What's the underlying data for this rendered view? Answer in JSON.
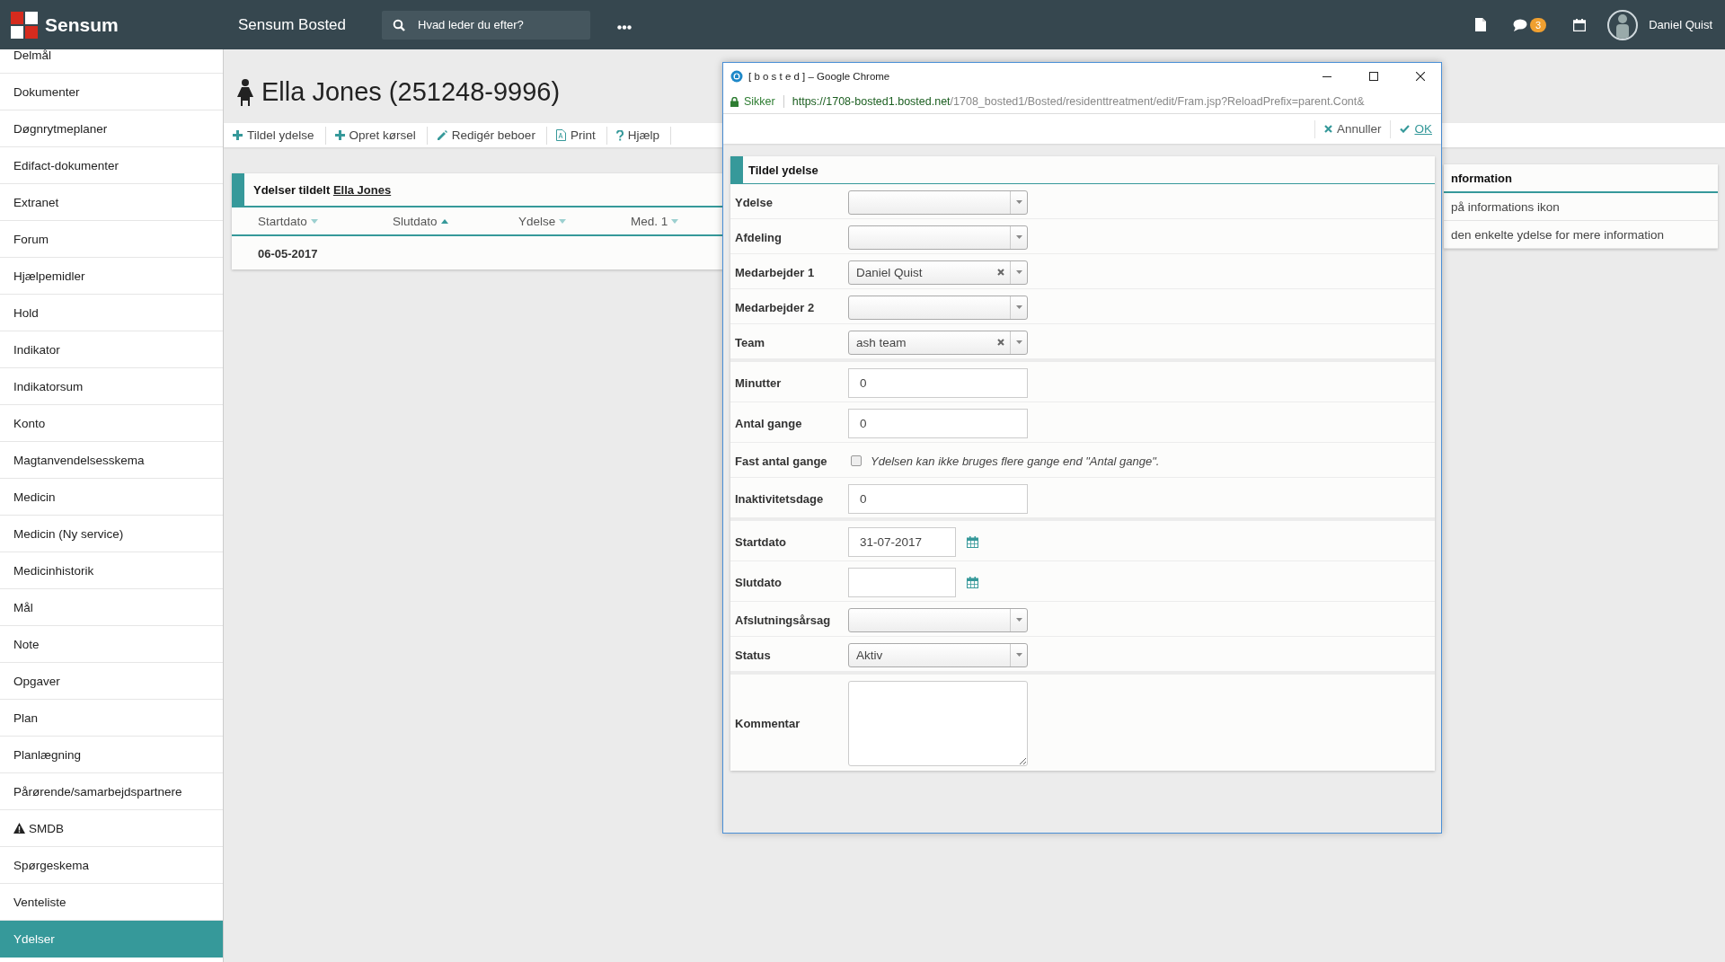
{
  "top_bar": {
    "logo_text": "Sensum",
    "app_title": "Sensum Bosted",
    "search": {
      "placeholder": "Hvad leder du efter?"
    },
    "notification_count": "3",
    "user_name": "Daniel Quist"
  },
  "sidebar": {
    "items": [
      {
        "label": "Delmål",
        "kind": "plain",
        "selected": false
      },
      {
        "label": "Dokumenter",
        "kind": "plain",
        "selected": false
      },
      {
        "label": "Døgnrytmeplaner",
        "kind": "plain",
        "selected": false
      },
      {
        "label": "Edifact-dokumenter",
        "kind": "plain",
        "selected": false
      },
      {
        "label": "Extranet",
        "kind": "plain",
        "selected": false
      },
      {
        "label": "Forum",
        "kind": "plain",
        "selected": false
      },
      {
        "label": "Hjælpemidler",
        "kind": "plain",
        "selected": false
      },
      {
        "label": "Hold",
        "kind": "plain",
        "selected": false
      },
      {
        "label": "Indikator",
        "kind": "plain",
        "selected": false
      },
      {
        "label": "Indikatorsum",
        "kind": "plain",
        "selected": false
      },
      {
        "label": "Konto",
        "kind": "plain",
        "selected": false
      },
      {
        "label": "Magtanvendelsesskema",
        "kind": "plain",
        "selected": false
      },
      {
        "label": "Medicin",
        "kind": "plain",
        "selected": false
      },
      {
        "label": "Medicin (Ny service)",
        "kind": "plain",
        "selected": false
      },
      {
        "label": "Medicinhistorik",
        "kind": "plain",
        "selected": false
      },
      {
        "label": "Mål",
        "kind": "plain",
        "selected": false
      },
      {
        "label": "Note",
        "kind": "plain",
        "selected": false
      },
      {
        "label": "Opgaver",
        "kind": "plain",
        "selected": false
      },
      {
        "label": "Plan",
        "kind": "plain",
        "selected": false
      },
      {
        "label": "Planlægning",
        "kind": "plain",
        "selected": false
      },
      {
        "label": "Pårørende/samarbejdspartnere",
        "kind": "plain",
        "selected": false
      },
      {
        "label": "SMDB",
        "kind": "warning",
        "selected": false
      },
      {
        "label": "Spørgeskema",
        "kind": "plain",
        "selected": false
      },
      {
        "label": "Venteliste",
        "kind": "plain",
        "selected": false
      },
      {
        "label": "Ydelser",
        "kind": "plain",
        "selected": true
      }
    ]
  },
  "resident": {
    "title": "Ella Jones (251248-9996)"
  },
  "toolbar": {
    "actions": [
      {
        "label": "Tildel ydelse",
        "kind": "add"
      },
      {
        "label": "Opret kørsel",
        "kind": "add"
      },
      {
        "label": "Redigér beboer",
        "kind": "edit"
      },
      {
        "label": "Print",
        "kind": "pdf"
      },
      {
        "label": "Hjælp",
        "kind": "help"
      }
    ]
  },
  "services_card": {
    "title": "Ydelser tildelt",
    "title_link": "Ella Jones",
    "columns": [
      {
        "label": "Startdato",
        "selected": false,
        "ascending": false
      },
      {
        "label": "Slutdato",
        "selected": true,
        "ascending": true
      },
      {
        "label": "Ydelse",
        "selected": false,
        "ascending": false
      },
      {
        "label": "Med. 1",
        "selected": false,
        "ascending": false
      }
    ],
    "rows": [
      {
        "cells": [
          "06-05-2017"
        ]
      }
    ]
  },
  "info_card": {
    "title": "nformation",
    "lines": [
      "på informations ikon",
      "den enkelte ydelse for mere information"
    ]
  },
  "popup": {
    "title": "[ b o s t e d ] – Google Chrome",
    "secure_label": "Sikker",
    "url_host": "https://1708-bosted1.bosted.net",
    "url_path": "/1708_bosted1/Bosted/residenttreatment/edit/Fram.jsp?ReloadPrefix=parent.Cont&",
    "cancel_label": "Annuller",
    "ok_label": "OK",
    "form": {
      "title": "Tildel ydelse",
      "sections": [
        {
          "fields": [
            {
              "label": "Ydelse",
              "kind": "select",
              "clearable": false
            },
            {
              "label": "Afdeling",
              "kind": "select",
              "clearable": false
            },
            {
              "label": "Medarbejder 1",
              "kind": "select",
              "value": "Daniel Quist",
              "clearable": true
            },
            {
              "label": "Medarbejder 2",
              "kind": "select",
              "clearable": false
            },
            {
              "label": "Team",
              "kind": "select",
              "value": "ash team",
              "clearable": true
            }
          ]
        },
        {
          "fields": [
            {
              "label": "Minutter",
              "kind": "text",
              "value": "0"
            },
            {
              "label": "Antal gange",
              "kind": "text",
              "value": "0"
            },
            {
              "label": "Fast antal gange",
              "kind": "checkbox",
              "checked": false,
              "hint": "Ydelsen kan ikke bruges flere gange end \"Antal gange\"."
            },
            {
              "label": "Inaktivitetsdage",
              "kind": "text",
              "value": "0"
            }
          ]
        },
        {
          "fields": [
            {
              "label": "Startdato",
              "kind": "date",
              "value": "31-07-2017"
            },
            {
              "label": "Slutdato",
              "kind": "date"
            },
            {
              "label": "Afslutningsårsag",
              "kind": "select",
              "clearable": false
            },
            {
              "label": "Status",
              "kind": "select",
              "value": "Aktiv",
              "clearable": false
            }
          ]
        },
        {
          "fields": [
            {
              "label": "Kommentar",
              "kind": "textarea"
            }
          ]
        }
      ]
    }
  }
}
